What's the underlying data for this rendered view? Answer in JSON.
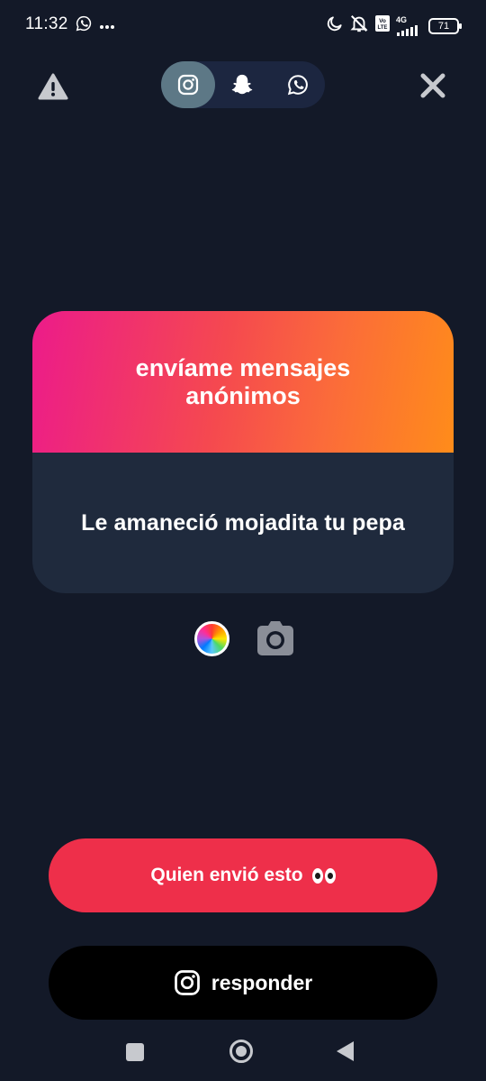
{
  "status_bar": {
    "time": "11:32",
    "network": "4G",
    "battery": "71",
    "icons": [
      "whatsapp-icon",
      "more-dots-icon",
      "moon-icon",
      "mute-icon",
      "volte-icon",
      "signal-icon",
      "battery-icon"
    ]
  },
  "toolbar": {
    "share_options": [
      "instagram",
      "snapchat",
      "whatsapp"
    ],
    "selected_option": "instagram",
    "icons": [
      "warning-icon",
      "instagram-icon",
      "snapchat-icon",
      "whatsapp-icon",
      "close-icon"
    ]
  },
  "card": {
    "title": "envíame mensajes anónimos",
    "message": "Le amaneció mojadita tu pepa"
  },
  "actions": {
    "who_sent_label": "Quien envió esto",
    "who_sent_emoji": "eyes-icon",
    "reply_label": "responder"
  },
  "colors": {
    "background": "#131928",
    "card_body": "#1f2a3d",
    "gradient_start": "#ec1b8a",
    "gradient_end": "#ff8c1a",
    "primary_button": "#ee2f4a",
    "reply_button": "#000000",
    "selected_tab": "#5d7886"
  }
}
